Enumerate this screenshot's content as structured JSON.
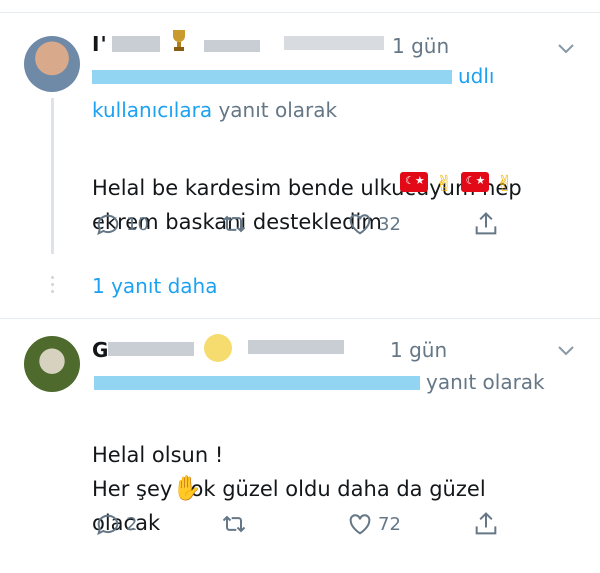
{
  "tweets": [
    {
      "name_visible": "I'",
      "time": "1 gün",
      "reply_to_visible_end": "udlı",
      "reply_to_line2": "kullanıcılara",
      "reply_to_suffix": "yanıt olarak",
      "text": "Helal be kardesim bende ulkucuyum  hep\nekrem baskani destekledim",
      "actions": {
        "reply_count": "10",
        "retweet_count": "",
        "like_count": "32"
      },
      "more_replies": "1 yanıt daha"
    },
    {
      "name_visible": "G",
      "time": "1 gün",
      "reply_to_suffix": "yanıt olarak",
      "text": "Helal olsun !\nHer şey çok güzel oldu daha da güzel\nolacak",
      "actions": {
        "reply_count": "2",
        "retweet_count": "",
        "like_count": "72"
      }
    }
  ],
  "icons": [
    "avatar",
    "chevron-down-icon",
    "reply-icon",
    "retweet-icon",
    "like-icon",
    "share-icon",
    "turkey-flag-icon",
    "horns-emoji",
    "folded-hands-emoji"
  ],
  "colors": {
    "link": "#1da1f2",
    "muted": "#657786",
    "text": "#14171a",
    "divider": "#e6ecf0"
  }
}
